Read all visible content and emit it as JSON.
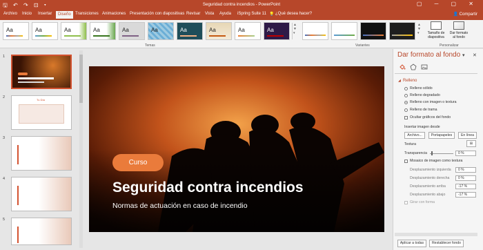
{
  "window": {
    "title": "Seguridad contra incendios - PowerPoint",
    "qat": "🖫 ↶ ↷ ⊡ ▾",
    "win_controls": "▢ ─ ▢ ✕"
  },
  "tabs": [
    "Archivo",
    "Inicio",
    "Insertar",
    "Diseño",
    "Transiciones",
    "Animaciones",
    "Presentación con diapositivas",
    "Revisar",
    "Vista",
    "Ayuda",
    "iSpring Suite 11"
  ],
  "tell_me": "¿Qué desea hacer?",
  "share": "Compartir",
  "ribbon": {
    "theme_sample": "Aa",
    "group_temas": "Temas",
    "group_variantes": "Variantes",
    "group_personalizar": "Personalizar",
    "slide_size": "Tamaño de diapositiva",
    "format_bg": "Dar formato al fondo"
  },
  "slides": {
    "numbers": [
      "1",
      "2",
      "3",
      "4",
      "5"
    ],
    "s2_title": "Tu Día"
  },
  "main_slide": {
    "badge": "Curso",
    "title": "Seguridad contra incendios",
    "subtitle": "Normas de actuación en caso de incendio"
  },
  "panel": {
    "title": "Dar formato al fondo",
    "relleno": "Relleno",
    "options": [
      "Relleno sólido",
      "Relleno degradado",
      "Relleno con imagen o textura",
      "Relleno de trama"
    ],
    "ocultar": "Ocultar gráficos del fondo",
    "insertar": "Insertar imagen desde",
    "btn_archivo": "Archivo...",
    "btn_portapapeles": "Portapapeles",
    "btn_enlinea": "En línea",
    "textura": "Textura",
    "transparencia": "Transparencia",
    "mosaico": "Mosaico de imagen como textura",
    "offsets": [
      {
        "label": "Desplazamiento izquierda",
        "value": "0 %"
      },
      {
        "label": "Desplazamiento derecha",
        "value": "0 %"
      },
      {
        "label": "Desplazamiento arriba",
        "value": "-17 %"
      },
      {
        "label": "Desplazamiento abajo",
        "value": "-17 %"
      }
    ],
    "transp_value": "0 %",
    "girar": "Girar con forma",
    "aplicar": "Aplicar a todas",
    "restablecer": "Restablecer fondo"
  }
}
